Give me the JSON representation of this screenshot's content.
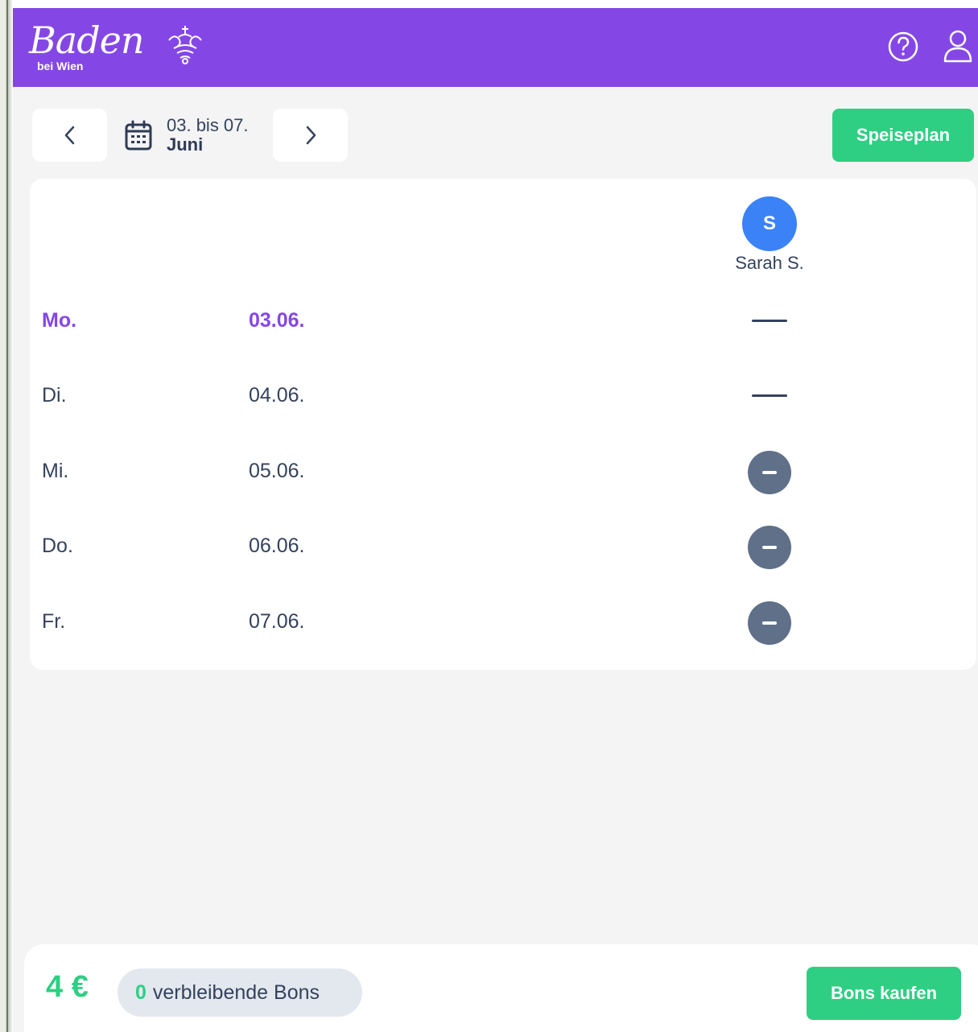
{
  "header": {
    "logo_text": "Baden",
    "logo_subtext": "bei Wien",
    "help_icon": "help-circle-icon",
    "user_icon": "user-icon",
    "color": "#8447e6"
  },
  "week_nav": {
    "range": "03. bis 07.",
    "month": "Juni",
    "prev_icon": "chevron-left-icon",
    "next_icon": "chevron-right-icon",
    "calendar_icon": "calendar-icon"
  },
  "actions": {
    "menu_label": "Speiseplan",
    "buy_label": "Bons kaufen",
    "accent": "#2ecf83"
  },
  "person": {
    "initial": "S",
    "name": "Sarah S.",
    "avatar_color": "#3b82f6"
  },
  "days": [
    {
      "name": "Mo.",
      "date": "03.06.",
      "today": true,
      "status": "none"
    },
    {
      "name": "Di.",
      "date": "04.06.",
      "today": false,
      "status": "none"
    },
    {
      "name": "Mi.",
      "date": "05.06.",
      "today": false,
      "status": "not-ordered"
    },
    {
      "name": "Do.",
      "date": "06.06.",
      "today": false,
      "status": "not-ordered"
    },
    {
      "name": "Fr.",
      "date": "07.06.",
      "today": false,
      "status": "not-ordered"
    }
  ],
  "footer": {
    "balance": "4 €",
    "bons_count": "0",
    "bons_label": "verbleibende Bons"
  }
}
